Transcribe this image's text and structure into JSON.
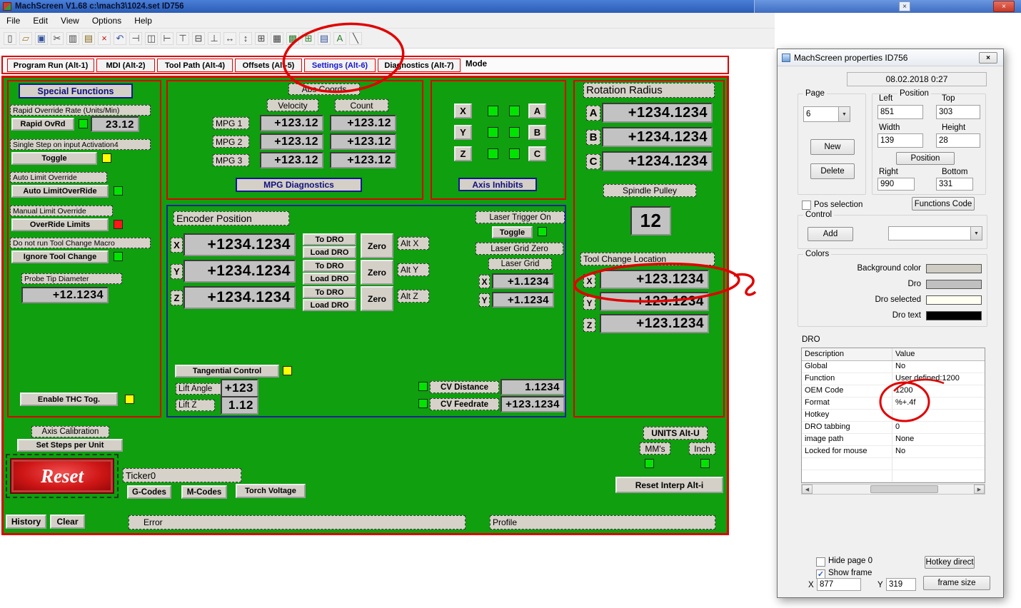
{
  "window": {
    "title": "MachScreen V1.68   c:\\mach3\\1024.set   ID756",
    "menu_items": [
      "File",
      "Edit",
      "View",
      "Options",
      "Help"
    ]
  },
  "toolbar": {
    "icons": [
      {
        "name": "new-icon",
        "glyph": "▯",
        "color": "#444444"
      },
      {
        "name": "open-icon",
        "glyph": "▱",
        "color": "#9a7b2d"
      },
      {
        "name": "save-icon",
        "glyph": "▣",
        "color": "#34539c"
      },
      {
        "name": "cut-icon",
        "glyph": "✂",
        "color": "#444444"
      },
      {
        "name": "copy-icon",
        "glyph": "▥",
        "color": "#444444"
      },
      {
        "name": "paste-icon",
        "glyph": "▤",
        "color": "#8a6a20"
      },
      {
        "name": "delete-icon",
        "glyph": "×",
        "color": "#cc1111"
      },
      {
        "name": "undo-icon",
        "glyph": "↶",
        "color": "#34539c"
      },
      {
        "name": "align-left-icon",
        "glyph": "⊣",
        "color": "#444444"
      },
      {
        "name": "align-center-h-icon",
        "glyph": "◫",
        "color": "#444444"
      },
      {
        "name": "align-right-icon",
        "glyph": "⊢",
        "color": "#444444"
      },
      {
        "name": "align-top-icon",
        "glyph": "⊤",
        "color": "#444444"
      },
      {
        "name": "align-middle-icon",
        "glyph": "⊟",
        "color": "#444444"
      },
      {
        "name": "align-bottom-icon",
        "glyph": "⊥",
        "color": "#444444"
      },
      {
        "name": "same-width-icon",
        "glyph": "↔",
        "color": "#444444"
      },
      {
        "name": "same-height-icon",
        "glyph": "↕",
        "color": "#444444"
      },
      {
        "name": "same-size-icon",
        "glyph": "⊞",
        "color": "#444444"
      },
      {
        "name": "grid-icon",
        "glyph": "▦",
        "color": "#444444"
      },
      {
        "name": "snap-icon",
        "glyph": "▩",
        "color": "#2e7d2e"
      },
      {
        "name": "add-control-icon",
        "glyph": "⊞",
        "color": "#2e7d2e"
      },
      {
        "name": "print-icon",
        "glyph": "▤",
        "color": "#34539c"
      },
      {
        "name": "font-icon",
        "glyph": "A",
        "color": "#2e7d2e"
      },
      {
        "name": "line-icon",
        "glyph": "╲",
        "color": "#444444"
      }
    ]
  },
  "tabs": {
    "items": [
      "Program Run (Alt-1)",
      "MDI (Alt-2)",
      "Tool Path (Alt-4)",
      "Offsets (Alt-5)",
      "Settings (Alt-6)",
      "Diagnostics (Alt-7)"
    ],
    "mode_label": "Mode"
  },
  "special": {
    "title": "Special Functions",
    "rapid_label": "Rapid Override Rate (Units/Min)",
    "rapid_button": "Rapid OvRd",
    "rapid_value": "23.12",
    "single_step_label": "Single Step on input Activation4",
    "toggle_button": "Toggle",
    "auto_limit_label": "Auto Limit Override",
    "auto_limit_button": "Auto LimitOverRide",
    "manual_limit_label": "Manual Limit Override",
    "override_limits_button": "OverRide Limits",
    "no_toolchange_label": "Do not run Tool Change Macro",
    "ignore_toolchange_button": "Ignore Tool Change",
    "probe_label": "Probe Tip Diameter",
    "probe_value": "+12.1234",
    "thc_button": "Enable THC Tog."
  },
  "mpg": {
    "header": "Abs Coords",
    "velocity_label": "Velocity",
    "count_label": "Count",
    "rows": [
      {
        "label": "MPG 1",
        "velocity": "+123.12",
        "count": "+123.12"
      },
      {
        "label": "MPG 2",
        "velocity": "+123.12",
        "count": "+123.12"
      },
      {
        "label": "MPG 3",
        "velocity": "+123.12",
        "count": "+123.12"
      }
    ],
    "diagnostics_button": "MPG Diagnostics"
  },
  "inhibits": {
    "left_axes": [
      "X",
      "Y",
      "Z"
    ],
    "right_axes": [
      "A",
      "B",
      "C"
    ],
    "label": "Axis Inhibits"
  },
  "rotation": {
    "title": "Rotation Radius",
    "rows": [
      {
        "axis": "A",
        "value": "+1234.1234"
      },
      {
        "axis": "B",
        "value": "+1234.1234"
      },
      {
        "axis": "C",
        "value": "+1234.1234"
      }
    ],
    "pulley_label": "Spindle Pulley",
    "pulley_value": "12",
    "toolchange_title": "Tool Change Location",
    "toolchange_rows": [
      {
        "axis": "X",
        "value": "+123.1234"
      },
      {
        "axis": "Y",
        "value": "+123.1234"
      },
      {
        "axis": "Z",
        "value": "+123.1234"
      }
    ]
  },
  "encoder": {
    "title": "Encoder Position",
    "to_dro": "To DRO",
    "load_dro": "Load DRO",
    "zero": "Zero",
    "axes": [
      {
        "axis": "X",
        "value": "+1234.1234",
        "alt": "Alt X"
      },
      {
        "axis": "Y",
        "value": "+1234.1234",
        "alt": "Alt Y"
      },
      {
        "axis": "Z",
        "value": "+1234.1234",
        "alt": "Alt Z"
      }
    ],
    "tangential_button": "Tangential Control",
    "lift_angle_label": "Lift Angle",
    "lift_angle_value": "+123",
    "lift_z_label": "Lift Z",
    "lift_z_value": "1.12"
  },
  "laser": {
    "trigger_label": "Laser Trigger On",
    "toggle_button": "Toggle",
    "grid_zero_label": "Laser Grid Zero",
    "grid_label": "Laser Grid",
    "x_label": "X",
    "x_value": "+1.1234",
    "y_label": "Y",
    "y_value": "+1.1234"
  },
  "cv": {
    "distance_label": "CV Distance",
    "distance_value": "1.1234",
    "feedrate_label": "CV Feedrate",
    "feedrate_value": "+123.1234"
  },
  "bottom": {
    "axis_cal_label": "Axis Calibration",
    "steps_button": "Set Steps per Unit",
    "reset_button": "Reset",
    "ticker": "Ticker0",
    "gcodes_button": "G-Codes",
    "mcodes_button": "M-Codes",
    "torch_button": "Torch Voltage",
    "units_label": "UNITS Alt-U",
    "mm_label": "MM's",
    "inch_label": "Inch",
    "reset_interp_button": "Reset Interp Alt-i",
    "history_button": "History",
    "clear_button": "Clear",
    "error_label": "Error",
    "profile_label": "Profile"
  },
  "dialog": {
    "title": "MachScreen properties  ID756",
    "datetime": "08.02.2018  0:27",
    "page": {
      "label": "Page",
      "value": "6",
      "new_button": "New",
      "delete_button": "Delete"
    },
    "position": {
      "label": "Position",
      "left_label": "Left",
      "left_value": "851",
      "top_label": "Top",
      "top_value": "303",
      "width_label": "Width",
      "width_value": "139",
      "height_label": "Height",
      "height_value": "28",
      "button": "Position",
      "right_label": "Right",
      "right_value": "990",
      "bottom_label": "Bottom",
      "bottom_value": "331"
    },
    "pos_selection_label": "Pos selection",
    "functions_code_button": "Functions Code",
    "control": {
      "label": "Control",
      "add_button": "Add"
    },
    "colors": {
      "label": "Colors",
      "rows": [
        {
          "name": "Background color",
          "swatch": "#cfccc3"
        },
        {
          "name": "Dro",
          "swatch": "#c0c0c0"
        },
        {
          "name": "Dro selected",
          "swatch": "#fffff2"
        },
        {
          "name": "Dro text",
          "swatch": "#000000"
        }
      ]
    },
    "dro": {
      "label": "DRO",
      "header": [
        "Description",
        "Value"
      ],
      "rows": [
        [
          "Global",
          "No"
        ],
        [
          "Function",
          "User defined:1200"
        ],
        [
          "OEM Code",
          "1200"
        ],
        [
          "Format",
          "%+.4f"
        ],
        [
          "Hotkey",
          ""
        ],
        [
          "DRO tabbing",
          "0"
        ],
        [
          "image path",
          "None"
        ],
        [
          "Locked for mouse",
          "No"
        ]
      ]
    },
    "hide_page_label": "Hide page 0",
    "show_frame_label": "Show frame",
    "x_label": "X",
    "x_value": "877",
    "y_label": "Y",
    "y_value": "319",
    "hotkey_button": "Hotkey direct",
    "frame_size_button": "frame size"
  }
}
